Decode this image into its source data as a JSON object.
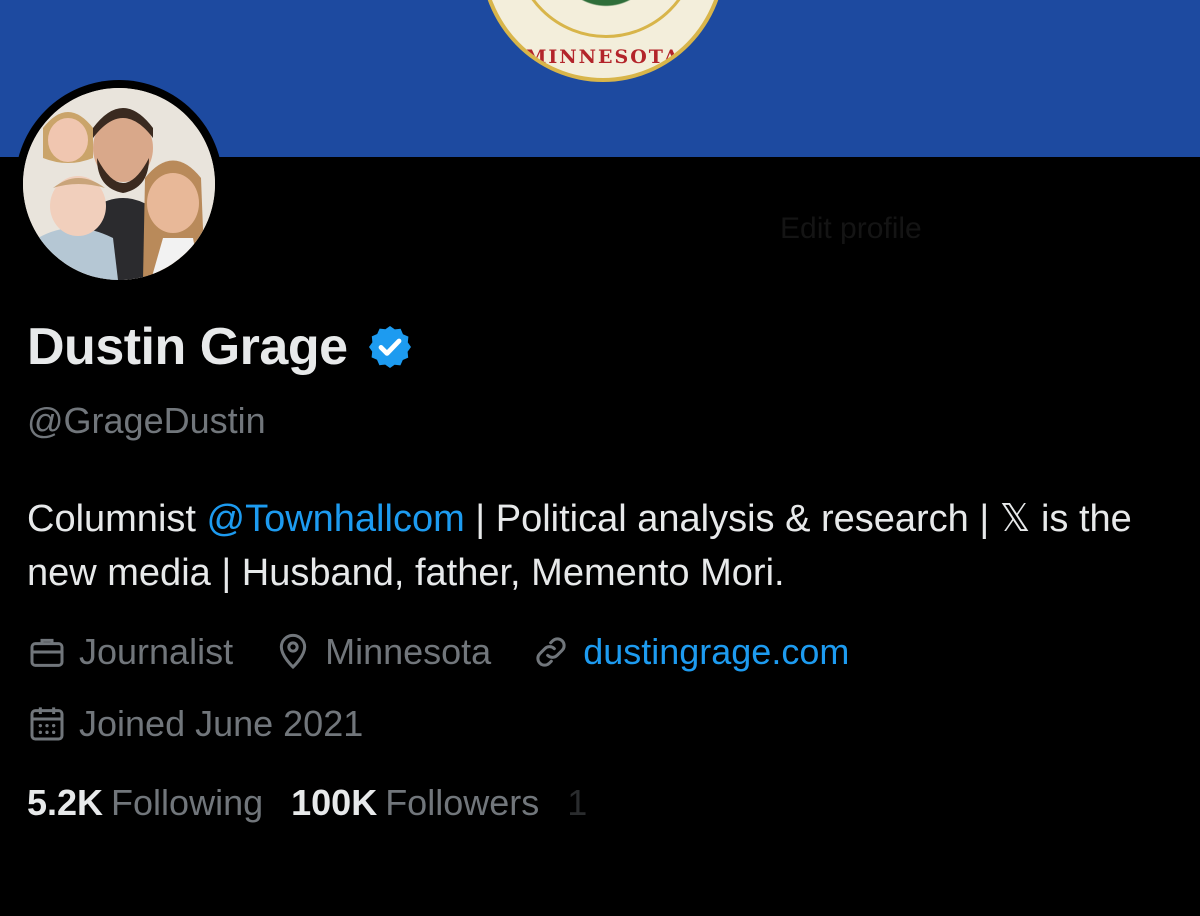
{
  "header": {
    "banner_color": "#1d4aa0",
    "banner_seal_text": "MINNESOTA"
  },
  "profile": {
    "name": "Dustin Grage",
    "verified": true,
    "verified_color": "#1d9bf0",
    "handle": "@GrageDustin",
    "bio": {
      "prefix": "Columnist ",
      "mention": "@Townhallcom",
      "rest": " | Political analysis & research | 𝕏 is the new media | Husband, father, Memento Mori."
    },
    "edit_button_ghost": "Edit profile",
    "category": "Journalist",
    "location": "Minnesota",
    "website": "dustingrage.com",
    "joined": "Joined June 2021"
  },
  "stats": {
    "following_count": "5.2K",
    "following_label": "Following",
    "followers_count": "100K",
    "followers_label": "Followers",
    "truncated": "1"
  },
  "icons": {
    "verified": "verified-badge-icon",
    "category": "briefcase-icon",
    "location": "map-pin-icon",
    "website": "link-icon",
    "joined": "calendar-icon"
  },
  "colors": {
    "background": "#000000",
    "text_primary": "#e7e9ea",
    "text_secondary": "#71767b",
    "accent": "#1d9bf0"
  }
}
